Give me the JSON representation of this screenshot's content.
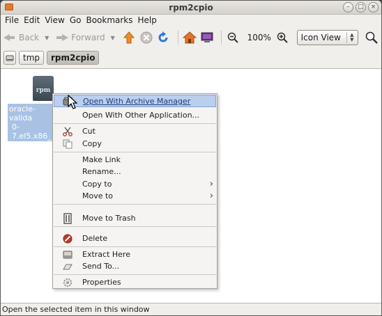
{
  "window": {
    "title": "rpm2cpio"
  },
  "menubar": {
    "items": [
      {
        "label": "File"
      },
      {
        "label": "Edit"
      },
      {
        "label": "View"
      },
      {
        "label": "Go"
      },
      {
        "label": "Bookmarks"
      },
      {
        "label": "Help"
      }
    ]
  },
  "toolbar": {
    "back_label": "Back",
    "forward_label": "Forward",
    "zoom_value": "100%",
    "view_mode": "Icon View"
  },
  "location": {
    "crumbs": [
      {
        "label": "tmp"
      },
      {
        "label": "rpm2cpio",
        "current": true
      }
    ]
  },
  "file": {
    "icon_text": "rpm",
    "label_line1": "oracle-valida",
    "label_line2": "0-7.el5.x86_"
  },
  "context_menu": {
    "items": [
      {
        "label": "Open With Archive Manager",
        "icon": "archive-icon",
        "highlighted": true
      },
      {
        "label": "Open With Other Application...",
        "icon": ""
      },
      {
        "label": "Cut",
        "icon": "cut-icon"
      },
      {
        "label": "Copy",
        "icon": "copy-icon"
      },
      {
        "label": "Make Link",
        "icon": ""
      },
      {
        "label": "Rename...",
        "icon": ""
      },
      {
        "label": "Copy to",
        "icon": "",
        "submenu": true
      },
      {
        "label": "Move to",
        "icon": "",
        "submenu": true
      },
      {
        "label": "Move to Trash",
        "icon": "trash-icon"
      },
      {
        "label": "Delete",
        "icon": "delete-icon"
      },
      {
        "label": "Extract Here",
        "icon": "extract-icon"
      },
      {
        "label": "Send To...",
        "icon": "send-icon"
      },
      {
        "label": "Properties",
        "icon": "properties-icon"
      }
    ]
  },
  "statusbar": {
    "text": "Open the selected item in this window"
  }
}
